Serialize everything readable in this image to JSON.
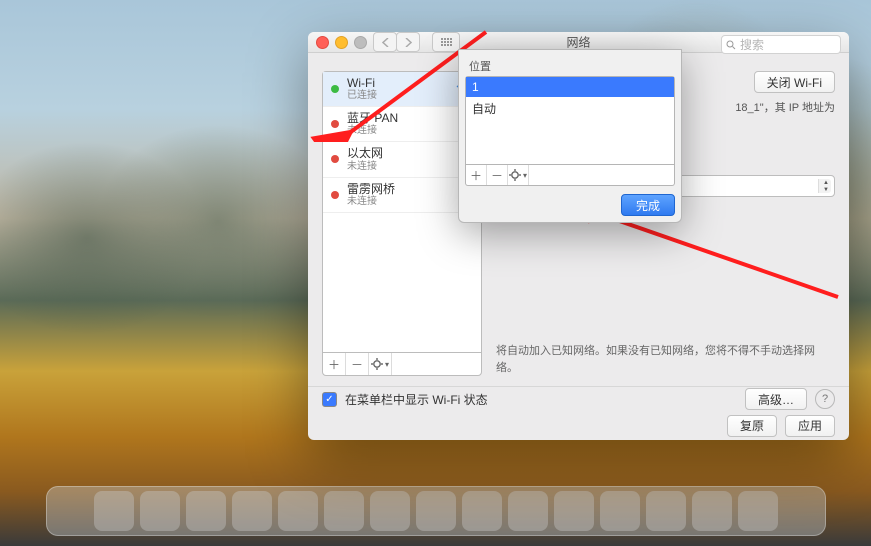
{
  "window": {
    "title": "网络",
    "search_placeholder": "搜索"
  },
  "sidebar": {
    "items": [
      {
        "name": "Wi-Fi",
        "status": "已连接",
        "status_color": "green",
        "icon": "wifi"
      },
      {
        "name": "蓝牙 PAN",
        "status": "未连接",
        "status_color": "red",
        "icon": "bluetooth"
      },
      {
        "name": "以太网",
        "status": "未连接",
        "status_color": "red",
        "icon": "ethernet"
      },
      {
        "name": "雷雳网桥",
        "status": "未连接",
        "status_color": "red",
        "icon": "bridge"
      }
    ]
  },
  "location": {
    "label": "位置",
    "input_value": "1",
    "options": [
      "自动"
    ],
    "done": "完成"
  },
  "detail": {
    "off_button": "关闭 Wi-Fi",
    "ip_fragment": "18_1\"，其 IP 地址为",
    "hint": "将自动加入已知网络。如果没有已知网络，您将不得不手动选择网络。",
    "advanced": "高级…"
  },
  "bottom": {
    "show_status": "在菜单栏中显示 Wi-Fi 状态"
  },
  "footer": {
    "revert": "复原",
    "apply": "应用"
  }
}
